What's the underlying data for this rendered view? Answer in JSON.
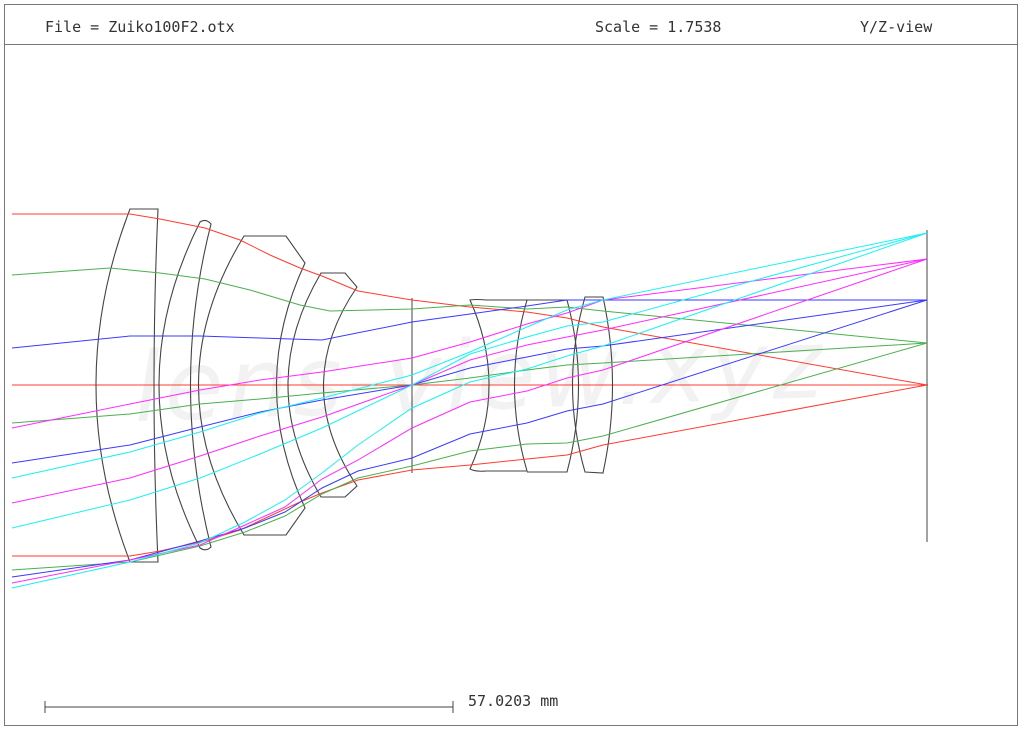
{
  "header": {
    "file": "File = Zuiko100F2.otx",
    "scale": "Scale = 1.7538",
    "view": "Y/Z-view"
  },
  "scale_bar": {
    "label": "57.0203 mm"
  },
  "watermark": "lens-view.xyz",
  "colors": {
    "frame": "#777777",
    "lens": "#444444",
    "ray_red": "#ff3b30",
    "ray_green": "#4caf50",
    "ray_blue": "#3a3aff",
    "ray_magenta": "#ff2bff",
    "ray_cyan": "#1ef0f0"
  }
}
